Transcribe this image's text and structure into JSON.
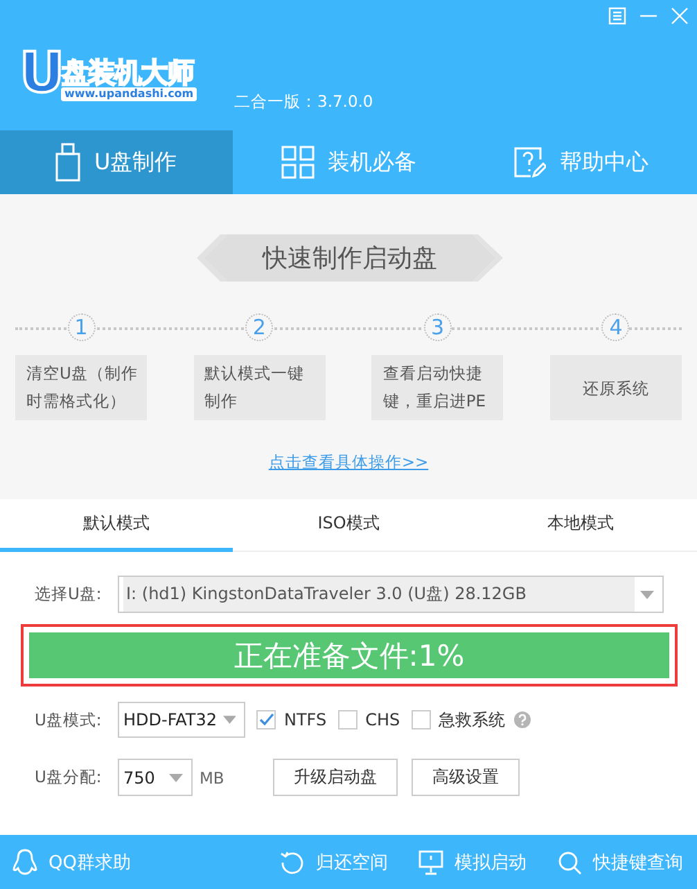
{
  "header": {
    "logo_letter": "U",
    "logo_title": "盘装机大师",
    "logo_url": "www.upandashi.com",
    "version": "二合一版：3.7.0.0"
  },
  "nav_tabs": [
    {
      "kind": "usb",
      "label": "U盘制作",
      "selected": true
    },
    {
      "kind": "apps",
      "label": "装机必备",
      "selected": false
    },
    {
      "kind": "help",
      "label": "帮助中心",
      "selected": false
    }
  ],
  "quick_start": {
    "title": "快速制作启动盘",
    "steps": [
      {
        "number": "1",
        "text": "清空U盘（制作时需格式化）"
      },
      {
        "number": "2",
        "text": "默认模式一键制作"
      },
      {
        "number": "3",
        "text": "查看启动快捷键，重启进PE"
      },
      {
        "number": "4",
        "text": "还原系统"
      }
    ],
    "link": "点击查看具体操作>>"
  },
  "mode_tabs": [
    {
      "label": "默认模式",
      "selected": true
    },
    {
      "label": "ISO模式",
      "selected": false
    },
    {
      "label": "本地模式",
      "selected": false
    }
  ],
  "usb_select": {
    "label": "选择U盘:",
    "value": "I: (hd1) KingstonDataTraveler 3.0 (U盘) 28.12GB",
    "disabled": true
  },
  "progress_button": {
    "label": "正在准备文件:1%"
  },
  "mode_row": {
    "label": "U盘模式:",
    "value": "HDD-FAT32",
    "checkboxes": [
      {
        "label": "NTFS",
        "checked": true
      },
      {
        "label": "CHS",
        "checked": false
      },
      {
        "label": "急救系统",
        "checked": false
      }
    ]
  },
  "partition_row": {
    "label": "U盘分配:",
    "value": "750",
    "unit": "MB",
    "buttons": [
      "升级启动盘",
      "高级设置"
    ]
  },
  "footer": [
    {
      "kind": "qq",
      "label": "QQ群求助"
    },
    {
      "kind": "restore",
      "label": "归还空间"
    },
    {
      "kind": "monitor",
      "label": "模拟启动"
    },
    {
      "kind": "search",
      "label": "快捷键查询"
    }
  ]
}
